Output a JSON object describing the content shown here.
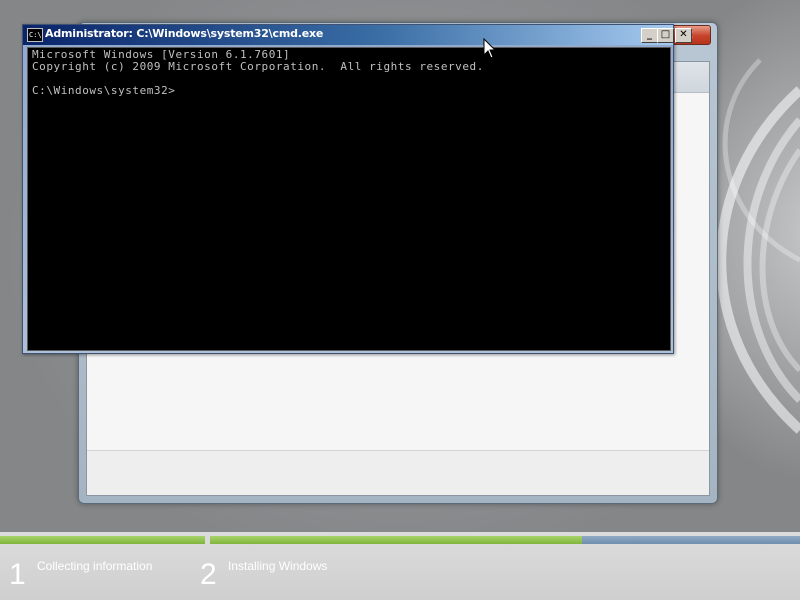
{
  "cmd": {
    "title": "Administrator: C:\\Windows\\system32\\cmd.exe",
    "minimize_glyph": "_",
    "maximize_glyph": "□",
    "close_glyph": "✕",
    "lines": [
      "Microsoft Windows [Version 6.1.7601]",
      "Copyright (c) 2009 Microsoft Corporation.  All rights reserved.",
      "",
      "C:\\Windows\\system32>"
    ]
  },
  "setup": {
    "close_glyph": "✕"
  },
  "progress": {
    "steps": [
      {
        "number": "1",
        "label": "Collecting information",
        "progress": 1.0
      },
      {
        "number": "2",
        "label": "Installing Windows",
        "progress": 0.63
      }
    ]
  },
  "colors": {
    "progress_done": "#7fb43c",
    "progress_remaining": "#6f8dac",
    "console_bg": "#000000",
    "console_text": "#c0c0c0"
  }
}
